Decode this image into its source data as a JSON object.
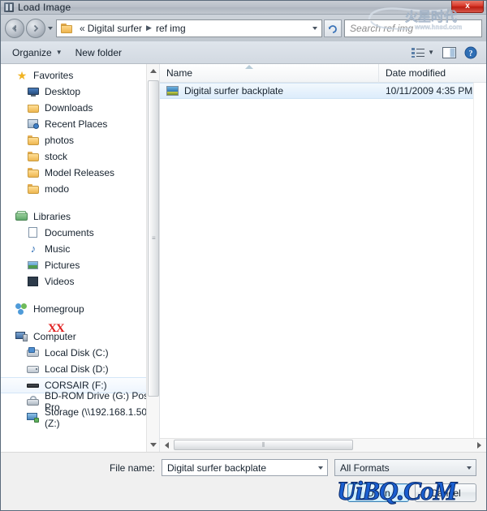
{
  "window": {
    "title": "Load Image",
    "close_label": "x",
    "title_icon": "app-icon"
  },
  "address": {
    "back_icon": "back-arrow-icon",
    "forward_icon": "forward-arrow-icon",
    "history_icon": "chevron-down-icon",
    "folder_icon": "folder-icon",
    "root_chevron": "«",
    "crumbs": [
      "Digital surfer",
      "ref img"
    ],
    "separator": "▶",
    "dropdown_icon": "chevron-down-icon",
    "refresh_icon": "refresh-icon",
    "search_placeholder": "Search ref img"
  },
  "toolbar": {
    "organize_label": "Organize",
    "organize_caret": "▼",
    "new_folder_label": "New folder",
    "view_icon": "view-list-icon",
    "view_caret": "▼",
    "preview_icon": "preview-pane-icon",
    "help_icon": "help-icon"
  },
  "sidebar": {
    "groups": [
      {
        "label": "Favorites",
        "icon": "star-icon",
        "icon_class": "ico-star",
        "items": [
          {
            "label": "Desktop",
            "icon": "desktop-icon",
            "icon_class": "ico-desktop"
          },
          {
            "label": "Downloads",
            "icon": "downloads-folder-icon",
            "icon_class": "ico-dl"
          },
          {
            "label": "Recent Places",
            "icon": "recent-places-icon",
            "icon_class": "ico-recent"
          },
          {
            "label": "photos",
            "icon": "folder-icon",
            "icon_class": "ico-folder"
          },
          {
            "label": "stock",
            "icon": "folder-icon",
            "icon_class": "ico-folder"
          },
          {
            "label": "Model Releases",
            "icon": "folder-icon",
            "icon_class": "ico-folder"
          },
          {
            "label": "modo",
            "icon": "folder-icon",
            "icon_class": "ico-folder"
          }
        ]
      },
      {
        "label": "Libraries",
        "icon": "libraries-icon",
        "icon_class": "ico-lib",
        "items": [
          {
            "label": "Documents",
            "icon": "documents-library-icon",
            "icon_class": "ico-doc"
          },
          {
            "label": "Music",
            "icon": "music-library-icon",
            "icon_class": "ico-music"
          },
          {
            "label": "Pictures",
            "icon": "pictures-library-icon",
            "icon_class": "ico-pic"
          },
          {
            "label": "Videos",
            "icon": "videos-library-icon",
            "icon_class": "ico-vid"
          }
        ]
      },
      {
        "label": "Homegroup",
        "icon": "homegroup-icon",
        "icon_class": "ico-home",
        "items": []
      },
      {
        "label": "Computer",
        "icon": "computer-icon",
        "icon_class": "ico-computer",
        "items": [
          {
            "label": "Local Disk (C:)",
            "icon": "system-drive-icon",
            "icon_class": "ico-hdd-sys"
          },
          {
            "label": "Local Disk (D:)",
            "icon": "hard-drive-icon",
            "icon_class": "ico-hdd"
          },
          {
            "label": "CORSAIR (F:)",
            "icon": "usb-drive-icon",
            "icon_class": "ico-usb",
            "hovered": true
          },
          {
            "label": "BD-ROM Drive (G:) Poser Pro",
            "icon": "optical-drive-icon",
            "icon_class": "ico-bd"
          },
          {
            "label": "Storage (\\\\192.168.1.50) (Z:)",
            "icon": "network-drive-icon",
            "icon_class": "ico-net"
          }
        ]
      }
    ],
    "annotation": "XX",
    "scrollbar": {
      "up_icon": "scroll-up-arrow",
      "down_icon": "scroll-down-arrow",
      "grip": "≡"
    }
  },
  "filelist": {
    "columns": [
      {
        "key": "name",
        "label": "Name",
        "sorted": true
      },
      {
        "key": "date",
        "label": "Date modified",
        "sorted": false
      }
    ],
    "rows": [
      {
        "name": "Digital surfer backplate",
        "date": "10/11/2009 4:35 PM",
        "icon": "image-file-icon",
        "selected": true
      }
    ],
    "hscroll": {
      "left_icon": "scroll-left-arrow",
      "right_icon": "scroll-right-arrow",
      "grip": "⦀"
    }
  },
  "footer": {
    "filename_label": "File name:",
    "filename_value": "Digital surfer backplate",
    "filename_caret": "▼",
    "filetype_value": "All Formats",
    "filetype_caret": "▼",
    "open_label": "Open",
    "cancel_label": "Cancel"
  },
  "watermarks": {
    "bottom_text": "UiBQ.CoM",
    "logo_text": "www.hnsd.com",
    "logo_cn": "火星时代"
  },
  "colors": {
    "selection": "#dcecfb",
    "accent": "#3c7fb1",
    "close_red": "#d9392b",
    "annotation_red": "#e02020",
    "watermark_blue": "#1a5fd0"
  }
}
